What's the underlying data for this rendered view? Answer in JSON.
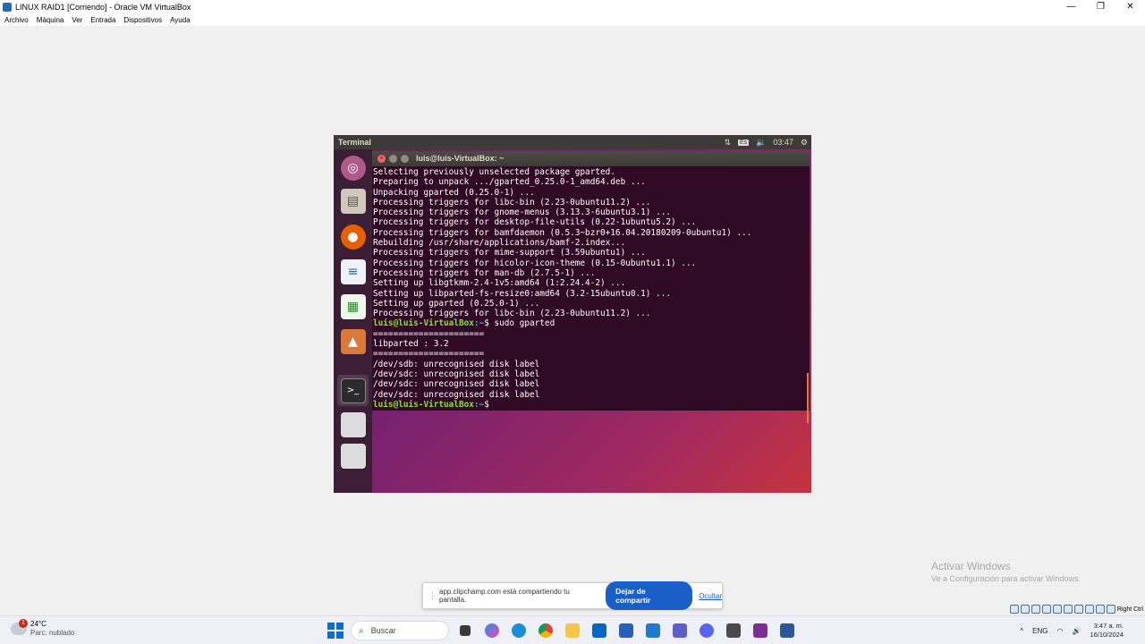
{
  "vbox": {
    "title": "LINUX RAID1 [Corriendo] - Oracle VM VirtualBox",
    "menu": [
      "Archivo",
      "Máquina",
      "Ver",
      "Entrada",
      "Dispositivos",
      "Ayuda"
    ],
    "status_right": "Right Ctrl"
  },
  "ubuntu": {
    "panel_title": "Terminal",
    "lang": "Es",
    "time": "03:47",
    "terminal_title": "luis@luis-VirtualBox: ~",
    "lines": [
      "Selecting previously unselected package gparted.",
      "Preparing to unpack .../gparted_0.25.0-1_amd64.deb ...",
      "Unpacking gparted (0.25.0-1) ...",
      "Processing triggers for libc-bin (2.23-0ubuntu11.2) ...",
      "Processing triggers for gnome-menus (3.13.3-6ubuntu3.1) ...",
      "Processing triggers for desktop-file-utils (0.22-1ubuntu5.2) ...",
      "Processing triggers for bamfdaemon (0.5.3~bzr0+16.04.20180209-0ubuntu1) ...",
      "Rebuilding /usr/share/applications/bamf-2.index...",
      "Processing triggers for mime-support (3.59ubuntu1) ...",
      "Processing triggers for hicolor-icon-theme (0.15-0ubuntu1.1) ...",
      "Processing triggers for man-db (2.7.5-1) ...",
      "Setting up libgtkmm-2.4-1v5:amd64 (1:2.24.4-2) ...",
      "Setting up libparted-fs-resize0:amd64 (3.2-15ubuntu0.1) ...",
      "Setting up gparted (0.25.0-1) ...",
      "Processing triggers for libc-bin (2.23-0ubuntu11.2) ..."
    ],
    "prompt_user": "luis@luis-VirtualBox",
    "prompt_path": ":~",
    "prompt_symbol": "$",
    "command": " sudo gparted",
    "output": [
      "======================",
      "libparted : 3.2",
      "======================",
      "/dev/sdb: unrecognised disk label",
      "/dev/sdc: unrecognised disk label",
      "/dev/sdc: unrecognised disk label",
      "/dev/sdc: unrecognised disk label"
    ]
  },
  "watermark": {
    "title": "Activar Windows",
    "subtitle": "Ve a Configuración para activar Windows."
  },
  "sharebar": {
    "message": "app.clipchamp.com está compartiendo tu pantalla.",
    "stop_label": "Dejar de compartir",
    "hide_label": "Ocultar"
  },
  "taskbar": {
    "temp": "24°C",
    "weather": "Parc. nublado",
    "weather_badge": "1",
    "search_placeholder": "Buscar",
    "lang": "ENG",
    "time": "3:47 a. m.",
    "date": "16/10/2024"
  },
  "colors": {
    "terminal_bg": "#300a24",
    "prompt_green": "#8ae234",
    "prompt_blue": "#729fcf",
    "share_button": "#1a5fc8"
  }
}
